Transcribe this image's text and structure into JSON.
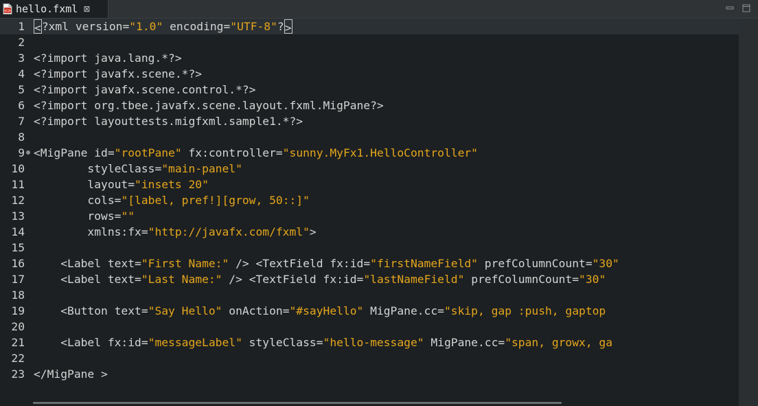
{
  "tab": {
    "file_name": "hello.fxml",
    "close_glyph": "⊠",
    "icon": "xml-file-icon"
  },
  "window_controls": {
    "minimize_icon": "minimize-icon",
    "maximize_icon": "maximize-icon"
  },
  "colors": {
    "background": "#1d2022",
    "string": "#e4a61c",
    "text": "#d4d4d4",
    "current_line": "#2b3034"
  },
  "editor": {
    "current_line": 1,
    "fold_marker_line": 9,
    "lines": [
      {
        "n": "1",
        "segments": [
          {
            "t": "<?xml version=",
            "c": "plain"
          },
          {
            "t": "\"1.0\"",
            "c": "str"
          },
          {
            "t": " encoding=",
            "c": "plain"
          },
          {
            "t": "\"UTF-8\"",
            "c": "str"
          },
          {
            "t": "?>",
            "c": "plain"
          }
        ]
      },
      {
        "n": "2",
        "segments": []
      },
      {
        "n": "3",
        "segments": [
          {
            "t": "<?import java.lang.*?>",
            "c": "plain"
          }
        ]
      },
      {
        "n": "4",
        "segments": [
          {
            "t": "<?import javafx.scene.*?>",
            "c": "plain"
          }
        ]
      },
      {
        "n": "5",
        "segments": [
          {
            "t": "<?import javafx.scene.control.*?>",
            "c": "plain"
          }
        ]
      },
      {
        "n": "6",
        "segments": [
          {
            "t": "<?import org.tbee.javafx.scene.layout.fxml.MigPane?>",
            "c": "plain"
          }
        ]
      },
      {
        "n": "7",
        "segments": [
          {
            "t": "<?import layouttests.migfxml.sample1.*?>",
            "c": "plain"
          }
        ]
      },
      {
        "n": "8",
        "segments": []
      },
      {
        "n": "9",
        "segments": [
          {
            "t": "<MigPane id=",
            "c": "plain"
          },
          {
            "t": "\"rootPane\"",
            "c": "str"
          },
          {
            "t": " fx:controller=",
            "c": "plain"
          },
          {
            "t": "\"sunny.MyFx1.HelloController\"",
            "c": "str"
          }
        ]
      },
      {
        "n": "10",
        "segments": [
          {
            "t": "        styleClass=",
            "c": "plain"
          },
          {
            "t": "\"main-panel\"",
            "c": "str"
          }
        ]
      },
      {
        "n": "11",
        "segments": [
          {
            "t": "        layout=",
            "c": "plain"
          },
          {
            "t": "\"insets 20\"",
            "c": "str"
          }
        ]
      },
      {
        "n": "12",
        "segments": [
          {
            "t": "        cols=",
            "c": "plain"
          },
          {
            "t": "\"[label, pref!][grow, 50::]\"",
            "c": "str"
          }
        ]
      },
      {
        "n": "13",
        "segments": [
          {
            "t": "        rows=",
            "c": "plain"
          },
          {
            "t": "\"\"",
            "c": "str"
          }
        ]
      },
      {
        "n": "14",
        "segments": [
          {
            "t": "        xmlns:fx=",
            "c": "plain"
          },
          {
            "t": "\"http://javafx.com/fxml\"",
            "c": "str"
          },
          {
            "t": ">",
            "c": "plain"
          }
        ]
      },
      {
        "n": "15",
        "segments": []
      },
      {
        "n": "16",
        "segments": [
          {
            "t": "    <Label text=",
            "c": "plain"
          },
          {
            "t": "\"First Name:\"",
            "c": "str"
          },
          {
            "t": " /> <TextField fx:id=",
            "c": "plain"
          },
          {
            "t": "\"firstNameField\"",
            "c": "str"
          },
          {
            "t": " prefColumnCount=",
            "c": "plain"
          },
          {
            "t": "\"30\"",
            "c": "str"
          }
        ]
      },
      {
        "n": "17",
        "segments": [
          {
            "t": "    <Label text=",
            "c": "plain"
          },
          {
            "t": "\"Last Name:\"",
            "c": "str"
          },
          {
            "t": " /> <TextField fx:id=",
            "c": "plain"
          },
          {
            "t": "\"lastNameField\"",
            "c": "str"
          },
          {
            "t": " prefColumnCount=",
            "c": "plain"
          },
          {
            "t": "\"30\"",
            "c": "str"
          }
        ]
      },
      {
        "n": "18",
        "segments": []
      },
      {
        "n": "19",
        "segments": [
          {
            "t": "    <Button text=",
            "c": "plain"
          },
          {
            "t": "\"Say Hello\"",
            "c": "str"
          },
          {
            "t": " onAction=",
            "c": "plain"
          },
          {
            "t": "\"#sayHello\"",
            "c": "str"
          },
          {
            "t": " MigPane.cc=",
            "c": "plain"
          },
          {
            "t": "\"skip, gap :push, gaptop",
            "c": "str"
          }
        ]
      },
      {
        "n": "20",
        "segments": []
      },
      {
        "n": "21",
        "segments": [
          {
            "t": "    <Label fx:id=",
            "c": "plain"
          },
          {
            "t": "\"messageLabel\"",
            "c": "str"
          },
          {
            "t": " styleClass=",
            "c": "plain"
          },
          {
            "t": "\"hello-message\"",
            "c": "str"
          },
          {
            "t": " MigPane.cc=",
            "c": "plain"
          },
          {
            "t": "\"span, growx, ga",
            "c": "str"
          }
        ]
      },
      {
        "n": "22",
        "segments": []
      },
      {
        "n": "23",
        "segments": [
          {
            "t": "</MigPane >",
            "c": "plain"
          }
        ]
      }
    ]
  }
}
